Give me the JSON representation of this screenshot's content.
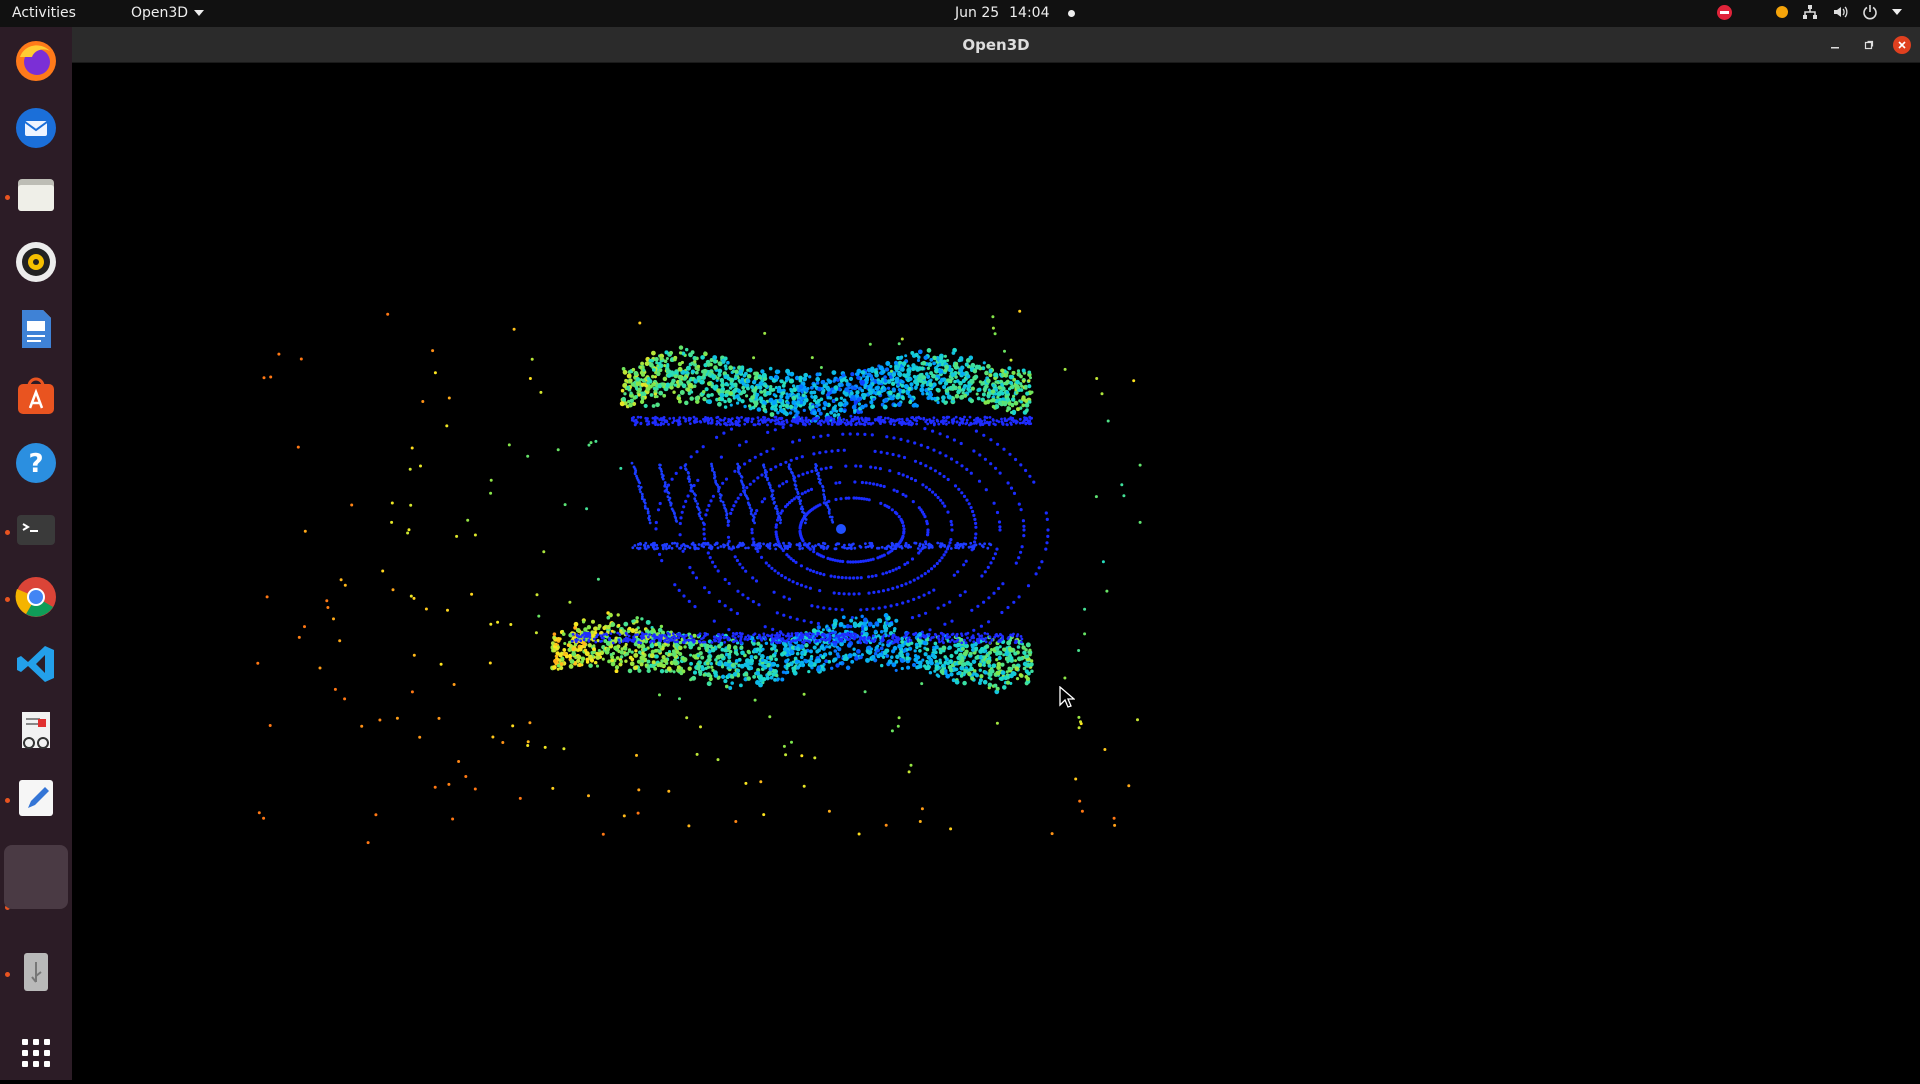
{
  "topbar": {
    "activities": "Activities",
    "app_menu": "Open3D",
    "date": "Jun 25",
    "time": "14:04"
  },
  "dock": {
    "items": [
      {
        "name": "firefox-icon",
        "running": false
      },
      {
        "name": "thunderbird-icon",
        "running": false
      },
      {
        "name": "files-icon",
        "running": true
      },
      {
        "name": "rhythmbox-icon",
        "running": false
      },
      {
        "name": "libreoffice-writer-icon",
        "running": false
      },
      {
        "name": "ubuntu-software-icon",
        "running": false
      },
      {
        "name": "help-icon",
        "running": false
      },
      {
        "name": "terminal-icon",
        "running": true
      },
      {
        "name": "chrome-icon",
        "running": true
      },
      {
        "name": "vscode-icon",
        "running": false
      },
      {
        "name": "document-viewer-icon",
        "running": false
      },
      {
        "name": "text-editor-icon",
        "running": true
      },
      {
        "name": "open3d-app-icon",
        "running": true
      },
      {
        "name": "usb-drive-icon",
        "running": true
      }
    ]
  },
  "window": {
    "title": "Open3D"
  },
  "colors": {
    "topbar": "#111111",
    "dock": "#2c1c26",
    "accent": "#e95420",
    "close": "#e0401f",
    "cloud_near": "#1030ff",
    "cloud_far": "#ffee22"
  }
}
